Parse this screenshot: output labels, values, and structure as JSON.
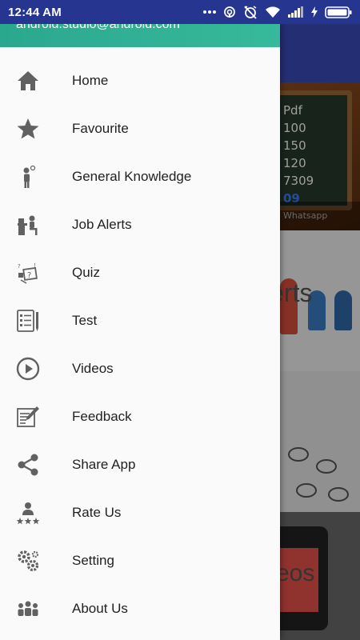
{
  "status_bar": {
    "time": "12:44 AM",
    "icons": [
      "more-dots-icon",
      "hotspot-icon",
      "alarm-off-icon",
      "wifi-icon",
      "signal-icon",
      "charging-icon",
      "battery-icon"
    ]
  },
  "background": {
    "card1_lines": [
      "Pdf",
      "100",
      "150",
      "120",
      "7309",
      "09",
      "Whatsapp"
    ],
    "card2_text": "lerts",
    "card4_text": "eos"
  },
  "drawer": {
    "email": "android.studio@android.com",
    "header_color": "#2fae93",
    "items": [
      {
        "label": "Home",
        "icon": "home-icon"
      },
      {
        "label": "Favourite",
        "icon": "star-icon"
      },
      {
        "label": "General Knowledge",
        "icon": "person-thinking-icon"
      },
      {
        "label": "Job Alerts",
        "icon": "person-desk-icon"
      },
      {
        "label": "Quiz",
        "icon": "quiz-icon"
      },
      {
        "label": "Test",
        "icon": "checklist-icon"
      },
      {
        "label": "Videos",
        "icon": "play-circle-icon"
      },
      {
        "label": "Feedback",
        "icon": "edit-note-icon"
      },
      {
        "label": "Share App",
        "icon": "share-icon"
      },
      {
        "label": "Rate Us",
        "icon": "rate-person-stars-icon"
      },
      {
        "label": "Setting",
        "icon": "gears-icon"
      },
      {
        "label": "About Us",
        "icon": "group-icon"
      }
    ]
  }
}
